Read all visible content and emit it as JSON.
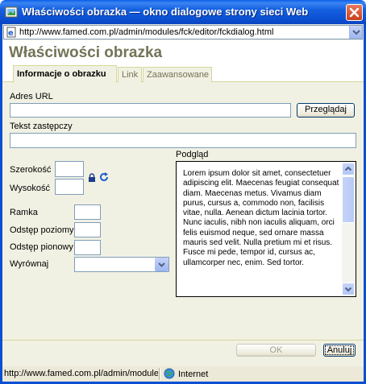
{
  "window": {
    "title": "Właściwości obrazka — okno dialogowe strony sieci Web",
    "url": "http://www.famed.com.pl/admin/modules/fck/editor/fckdialog.html"
  },
  "dialog": {
    "title": "Właściwości obrazka",
    "tabs": [
      {
        "label": "Informacje o obrazku",
        "active": true
      },
      {
        "label": "Link",
        "active": false
      },
      {
        "label": "Zaawansowane",
        "active": false
      }
    ],
    "url_label": "Adres URL",
    "url_value": "",
    "browse_button": "Przeglądaj",
    "alt_label": "Tekst zastępczy",
    "alt_value": "",
    "width_label": "Szerokość",
    "height_label": "Wysokość",
    "border_label": "Ramka",
    "hspace_label": "Odstęp poziomy",
    "vspace_label": "Odstęp pionowy",
    "align_label": "Wyrównaj",
    "align_value": "",
    "preview_label": "Podgląd",
    "preview_text": "Lorem ipsum dolor sit amet, consectetuer adipiscing elit. Maecenas feugiat consequat diam. Maecenas metus. Vivamus diam purus, cursus a, commodo non, facilisis vitae, nulla. Aenean dictum lacinia tortor. Nunc iaculis, nibh non iaculis aliquam, orci felis euismod neque, sed ornare massa mauris sed velit. Nulla pretium mi et risus. Fusce mi pede, tempor id, cursus ac, ullamcorper nec, enim. Sed tortor.",
    "ok_button": "OK",
    "cancel_button": "Anuluj"
  },
  "statusbar": {
    "url": "http://www.famed.com.pl/admin/modules/fck/editor/fckdialog.html",
    "zone": "Internet"
  },
  "colors": {
    "titlebar": "#0b4fd2",
    "dialog_bg": "#f1f1e3",
    "title_text": "#737357"
  }
}
